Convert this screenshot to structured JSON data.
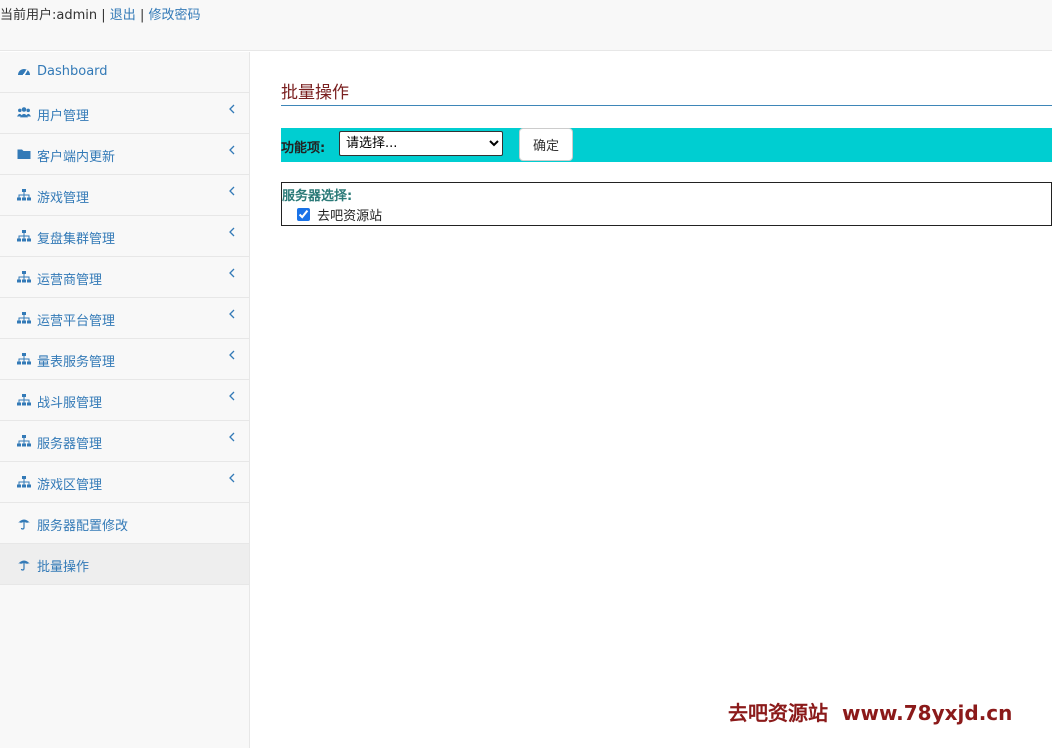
{
  "header": {
    "user_label": "当前用户:admin",
    "separator": "|",
    "logout_label": "退出",
    "change_password_label": "修改密码"
  },
  "sidebar": {
    "items": [
      {
        "label": "Dashboard",
        "icon": "dashboard-icon",
        "has_submenu": false,
        "active": false
      },
      {
        "label": "用户管理",
        "icon": "users-icon",
        "has_submenu": true,
        "active": false
      },
      {
        "label": "客户端内更新",
        "icon": "folder-icon",
        "has_submenu": true,
        "active": false
      },
      {
        "label": "游戏管理",
        "icon": "sitemap-icon",
        "has_submenu": true,
        "active": false
      },
      {
        "label": "复盘集群管理",
        "icon": "sitemap-icon",
        "has_submenu": true,
        "active": false
      },
      {
        "label": "运营商管理",
        "icon": "sitemap-icon",
        "has_submenu": true,
        "active": false
      },
      {
        "label": "运营平台管理",
        "icon": "sitemap-icon",
        "has_submenu": true,
        "active": false
      },
      {
        "label": "量表服务管理",
        "icon": "sitemap-icon",
        "has_submenu": true,
        "active": false
      },
      {
        "label": "战斗服管理",
        "icon": "sitemap-icon",
        "has_submenu": true,
        "active": false
      },
      {
        "label": "服务器管理",
        "icon": "sitemap-icon",
        "has_submenu": true,
        "active": false
      },
      {
        "label": "游戏区管理",
        "icon": "sitemap-icon",
        "has_submenu": true,
        "active": false
      },
      {
        "label": "服务器配置修改",
        "icon": "umbrella-icon",
        "has_submenu": false,
        "active": false
      },
      {
        "label": "批量操作",
        "icon": "umbrella-icon",
        "has_submenu": false,
        "active": true
      }
    ]
  },
  "main": {
    "title": "批量操作",
    "function_label": "功能项:",
    "select_value": "请选择...",
    "confirm_label": "确定",
    "server_section_title": "服务器选择:",
    "servers": [
      {
        "name": "去吧资源站",
        "checked": true
      }
    ]
  },
  "watermark": {
    "brand": "去吧资源站",
    "url": "www.78yxjd.cn"
  },
  "colors": {
    "link": "#337ab7",
    "toolbar_bg": "#00ced1",
    "title": "#7a1f1f",
    "title_underline": "#3e86b8",
    "watermark": "#8b1a1a"
  }
}
